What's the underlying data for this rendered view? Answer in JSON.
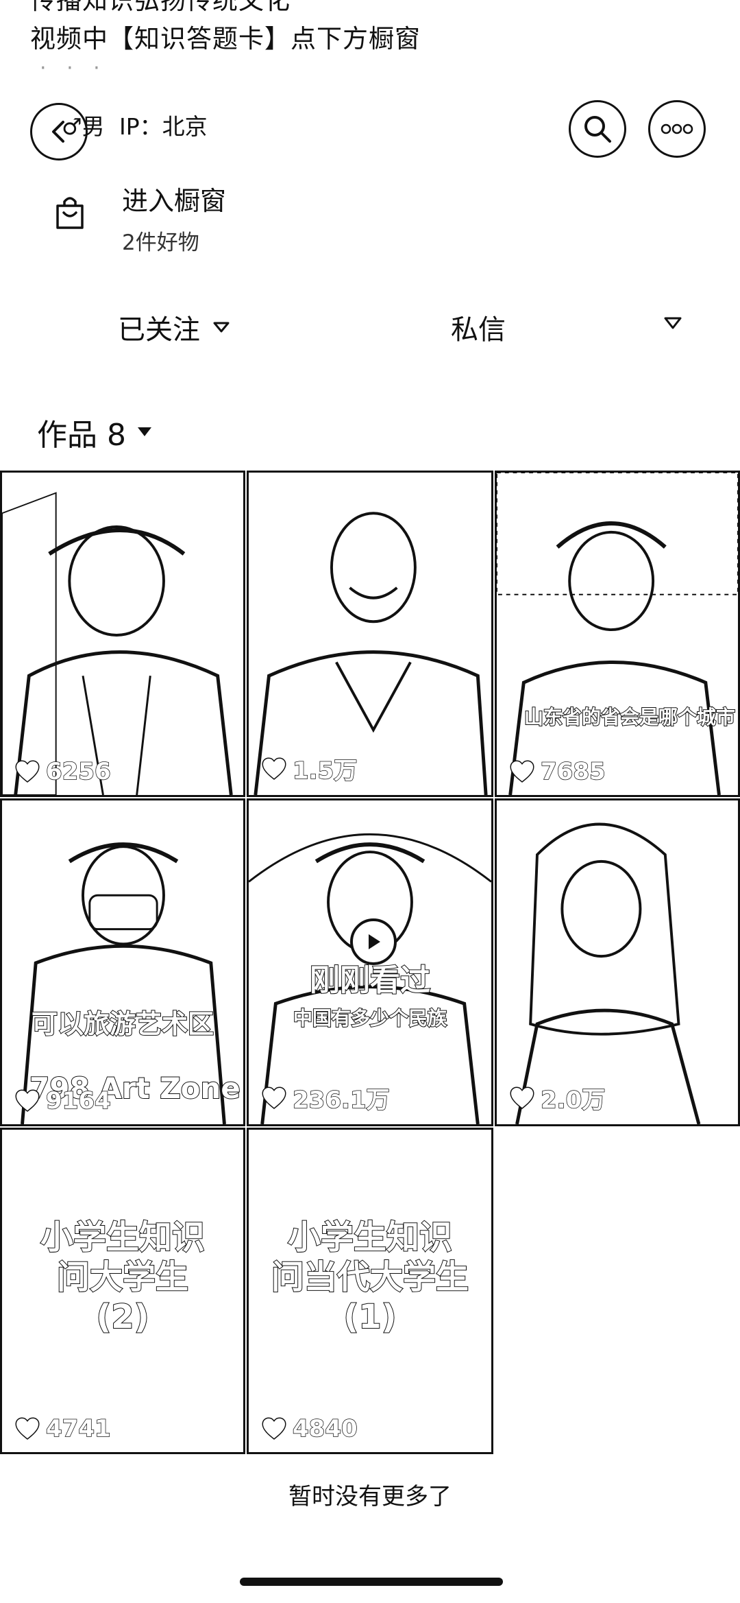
{
  "bio": {
    "line_top": "传播知识弘扬传统文化",
    "line_mid": "视频中【知识答题卡】点下方橱窗",
    "dots": "· · ·"
  },
  "profile": {
    "gender": "♂男",
    "ip": "IP：北京"
  },
  "shop": {
    "title": "进入橱窗",
    "subtitle": "2件好物"
  },
  "actions": {
    "follow_label": "已关注",
    "message_label": "私信"
  },
  "works": {
    "label": "作品 8"
  },
  "videos": [
    {
      "likes": "6256"
    },
    {
      "likes": "1.5万"
    },
    {
      "likes": "7685",
      "caption": "山东省的省会是哪个城市"
    },
    {
      "likes": "9164",
      "caption": "可以旅游艺术区",
      "caption2": "798 Art Zone"
    },
    {
      "likes": "236.1万",
      "caption": "刚刚看过",
      "caption2": "中国有多少个民族"
    },
    {
      "likes": "2.0万"
    },
    {
      "likes": "4741",
      "caption": "小学生知识\n问大学生\n(2)"
    },
    {
      "likes": "4840",
      "caption": "小学生知识\n问当代大学生\n(1)"
    }
  ],
  "footer": {
    "end_text": "暂时没有更多了"
  },
  "colors": {
    "background": "#ffffff",
    "text": "#111111"
  }
}
